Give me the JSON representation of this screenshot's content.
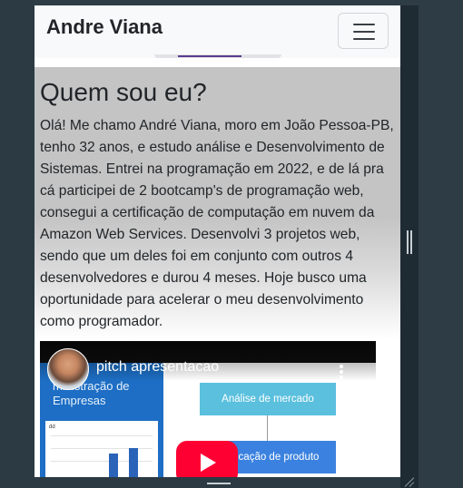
{
  "navbar": {
    "brand": "Andre Viana",
    "toggler_icon": "hamburger-menu-icon"
  },
  "about": {
    "title": "Quem sou eu?",
    "text": "Olá! Me chamo André Viana, moro em João Pessoa-PB, tenho 32 anos, e estudo análise e Desenvolvimento de Sistemas. Entrei na programação em 2022, e de lá pra cá participei de 2 bootcamp's de programação web, consegui a certificação de computação em nuvem da Amazon Web Services. Desenvolvi 3 projetos web, sendo que um deles foi em conjunto com outros 4 desenvolvedores e durou 4 meses. Hoje busco uma oportunidade para acelerar o meu desenvolvimento como programador."
  },
  "video": {
    "title": "pitch apresentacao",
    "slide_left_title": "ministração de Empresas",
    "box_top": "Análise de mercado",
    "box_bottom": "icação de produto",
    "chart_tag": "dd",
    "play_icon": "play-icon",
    "menu_icon": "more-vert-icon"
  },
  "colors": {
    "navbar_bg": "#f8f9fa",
    "section_bg": "#c4c4c4",
    "youtube_red": "#ff0033",
    "frame_bg": "#2d3c45"
  }
}
